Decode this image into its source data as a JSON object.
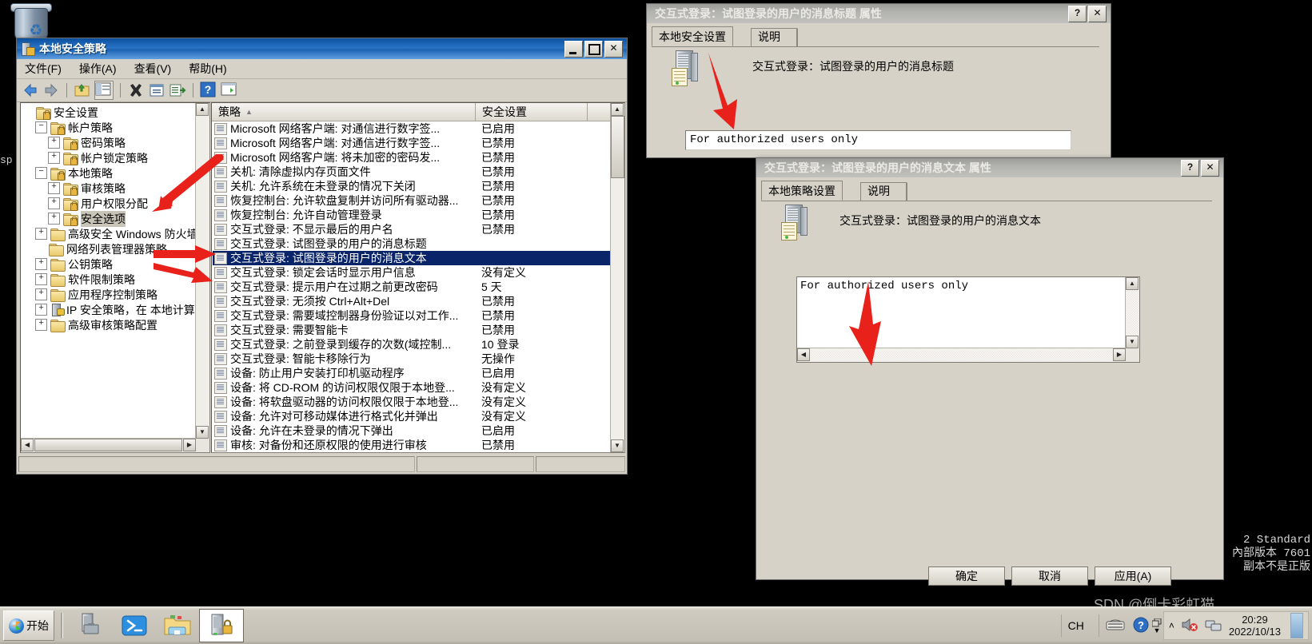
{
  "desktop": {
    "recycle_bin_name": "recycle-bin",
    "left_edge_text": "sp",
    "watermark": [
      "2 Standard",
      "內部版本 7601",
      "副本不是正版"
    ]
  },
  "main_window": {
    "title": "本地安全策略",
    "titlebar_buttons": {
      "minimize": "_",
      "maximize": "□",
      "close": "✕"
    },
    "menus": [
      "文件(F)",
      "操作(A)",
      "查看(V)",
      "帮助(H)"
    ],
    "toolbar_icons": [
      "back-icon",
      "forward-icon",
      "up-folder-icon",
      "show-tree-icon",
      "delete-icon",
      "properties-icon",
      "export-list-icon",
      "help-icon",
      "show-pane-icon"
    ],
    "tree": [
      {
        "label": "安全设置",
        "depth": 0,
        "expander": "",
        "icon": "security-settings-icon",
        "selected": false
      },
      {
        "label": "帐户策略",
        "depth": 1,
        "expander": "−",
        "icon": "folder-lock-icon",
        "selected": false
      },
      {
        "label": "密码策略",
        "depth": 2,
        "expander": "+",
        "icon": "folder-lock-icon",
        "selected": false
      },
      {
        "label": "帐户锁定策略",
        "depth": 2,
        "expander": "+",
        "icon": "folder-lock-icon",
        "selected": false
      },
      {
        "label": "本地策略",
        "depth": 1,
        "expander": "−",
        "icon": "folder-lock-icon",
        "selected": false
      },
      {
        "label": "审核策略",
        "depth": 2,
        "expander": "+",
        "icon": "folder-lock-icon",
        "selected": false
      },
      {
        "label": "用户权限分配",
        "depth": 2,
        "expander": "+",
        "icon": "folder-lock-icon",
        "selected": false
      },
      {
        "label": "安全选项",
        "depth": 2,
        "expander": "+",
        "icon": "folder-lock-icon",
        "selected": true
      },
      {
        "label": "高级安全 Windows 防火墙",
        "depth": 1,
        "expander": "+",
        "icon": "folder-icon",
        "selected": false
      },
      {
        "label": "网络列表管理器策略",
        "depth": 1,
        "expander": "",
        "icon": "folder-icon",
        "selected": false
      },
      {
        "label": "公钥策略",
        "depth": 1,
        "expander": "+",
        "icon": "folder-icon",
        "selected": false
      },
      {
        "label": "软件限制策略",
        "depth": 1,
        "expander": "+",
        "icon": "folder-icon",
        "selected": false
      },
      {
        "label": "应用程序控制策略",
        "depth": 1,
        "expander": "+",
        "icon": "folder-icon",
        "selected": false
      },
      {
        "label": "IP 安全策略，在 本地计算机",
        "depth": 1,
        "expander": "+",
        "icon": "ip-security-icon",
        "selected": false
      },
      {
        "label": "高级审核策略配置",
        "depth": 1,
        "expander": "+",
        "icon": "folder-icon",
        "selected": false
      }
    ],
    "columns": [
      "策略",
      "安全设置"
    ],
    "sort_indicator": "▲",
    "rows": [
      {
        "policy": "Microsoft 网络客户端: 对通信进行数字签...",
        "setting": "已启用",
        "selected": false
      },
      {
        "policy": "Microsoft 网络客户端: 对通信进行数字签...",
        "setting": "已禁用",
        "selected": false
      },
      {
        "policy": "Microsoft 网络客户端: 将未加密的密码发...",
        "setting": "已禁用",
        "selected": false
      },
      {
        "policy": "关机: 清除虚拟内存页面文件",
        "setting": "已禁用",
        "selected": false
      },
      {
        "policy": "关机: 允许系统在未登录的情况下关闭",
        "setting": "已禁用",
        "selected": false
      },
      {
        "policy": "恢复控制台: 允许软盘复制并访问所有驱动器...",
        "setting": "已禁用",
        "selected": false
      },
      {
        "policy": "恢复控制台: 允许自动管理登录",
        "setting": "已禁用",
        "selected": false
      },
      {
        "policy": "交互式登录: 不显示最后的用户名",
        "setting": "已禁用",
        "selected": false
      },
      {
        "policy": "交互式登录: 试图登录的用户的消息标题",
        "setting": "",
        "selected": false
      },
      {
        "policy": "交互式登录: 试图登录的用户的消息文本",
        "setting": "",
        "selected": true
      },
      {
        "policy": "交互式登录: 锁定会话时显示用户信息",
        "setting": "没有定义",
        "selected": false
      },
      {
        "policy": "交互式登录: 提示用户在过期之前更改密码",
        "setting": "5 天",
        "selected": false
      },
      {
        "policy": "交互式登录: 无须按 Ctrl+Alt+Del",
        "setting": "已禁用",
        "selected": false
      },
      {
        "policy": "交互式登录: 需要域控制器身份验证以对工作...",
        "setting": "已禁用",
        "selected": false
      },
      {
        "policy": "交互式登录: 需要智能卡",
        "setting": "已禁用",
        "selected": false
      },
      {
        "policy": "交互式登录: 之前登录到缓存的次数(域控制...",
        "setting": "10 登录",
        "selected": false
      },
      {
        "policy": "交互式登录: 智能卡移除行为",
        "setting": "无操作",
        "selected": false
      },
      {
        "policy": "设备: 防止用户安装打印机驱动程序",
        "setting": "已启用",
        "selected": false
      },
      {
        "policy": "设备: 将 CD-ROM 的访问权限仅限于本地登...",
        "setting": "没有定义",
        "selected": false
      },
      {
        "policy": "设备: 将软盘驱动器的访问权限仅限于本地登...",
        "setting": "没有定义",
        "selected": false
      },
      {
        "policy": "设备: 允许对可移动媒体进行格式化并弹出",
        "setting": "没有定义",
        "selected": false
      },
      {
        "policy": "设备: 允许在未登录的情况下弹出",
        "setting": "已启用",
        "selected": false
      },
      {
        "policy": "审核: 对备份和还原权限的使用进行审核",
        "setting": "已禁用",
        "selected": false
      }
    ]
  },
  "dialog_title": {
    "title": "交互式登录：试图登录的用户的消息标题 属性",
    "help_button": "?",
    "close_button": "✕",
    "tabs": [
      {
        "label": "本地安全设置",
        "active": true
      },
      {
        "label": "说明",
        "active": false
      }
    ],
    "heading": "交互式登录：试图登录的用户的消息标题",
    "input_value": "For authorized users only"
  },
  "dialog_text": {
    "title": "交互式登录：试图登录的用户的消息文本 属性",
    "help_button": "?",
    "close_button": "✕",
    "tabs": [
      {
        "label": "本地策略设置",
        "active": true
      },
      {
        "label": "说明",
        "active": false
      }
    ],
    "heading": "交互式登录：试图登录的用户的消息文本",
    "textarea_value": "For authorized users only",
    "buttons": [
      "确定",
      "取消",
      "应用(A)"
    ]
  },
  "taskbar": {
    "start_label": "开始",
    "items": [
      "server-manager-icon",
      "powershell-icon",
      "explorer-icon",
      "local-security-policy-icon"
    ],
    "tray": {
      "ime": "CH",
      "icons": [
        "keyboard-icon",
        "help-icon",
        "show-hidden-icon",
        "chevron-up-icon",
        "volume-muted-icon",
        "network-icon"
      ],
      "time": "20:29",
      "date": "2022/10/13"
    }
  },
  "annotations": {
    "watermark_text": "SDN @倒卡彩虹猫",
    "arrows": [
      "arrow-to-security-options",
      "arrow-to-policy-row",
      "arrow-to-policy-row-2",
      "arrow-to-title-input",
      "arrow-to-text-area"
    ]
  },
  "colors": {
    "titlebar_active": "#1d63b4",
    "selection": "#0a246a",
    "window_face": "#d6d2c8",
    "arrow_red": "#e8211a"
  }
}
